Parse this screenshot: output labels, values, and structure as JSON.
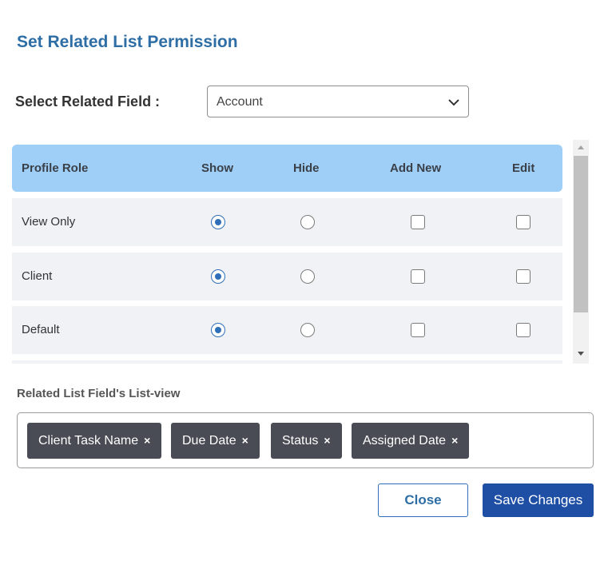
{
  "dialog": {
    "title": "Set Related List Permission"
  },
  "related_field": {
    "label": "Select Related Field :",
    "selected": "Account"
  },
  "table": {
    "headers": [
      "Profile Role",
      "Show",
      "Hide",
      "Add New",
      "Edit"
    ],
    "rows": [
      {
        "role": "View Only",
        "show": true,
        "hide": false,
        "add_new": false,
        "edit": false
      },
      {
        "role": "Client",
        "show": true,
        "hide": false,
        "add_new": false,
        "edit": false
      },
      {
        "role": "Default",
        "show": true,
        "hide": false,
        "add_new": false,
        "edit": false
      }
    ]
  },
  "list_view": {
    "label": "Related List Field's List-view",
    "tags": [
      "Client Task Name",
      "Due Date",
      "Status",
      "Assigned Date"
    ],
    "remove_glyph": "×"
  },
  "buttons": {
    "close": "Close",
    "save": "Save Changes"
  },
  "colors": {
    "title": "#2e6ea5",
    "header_bg": "#9fcff7",
    "primary": "#1f4fa5",
    "tag_bg": "#494c54"
  }
}
